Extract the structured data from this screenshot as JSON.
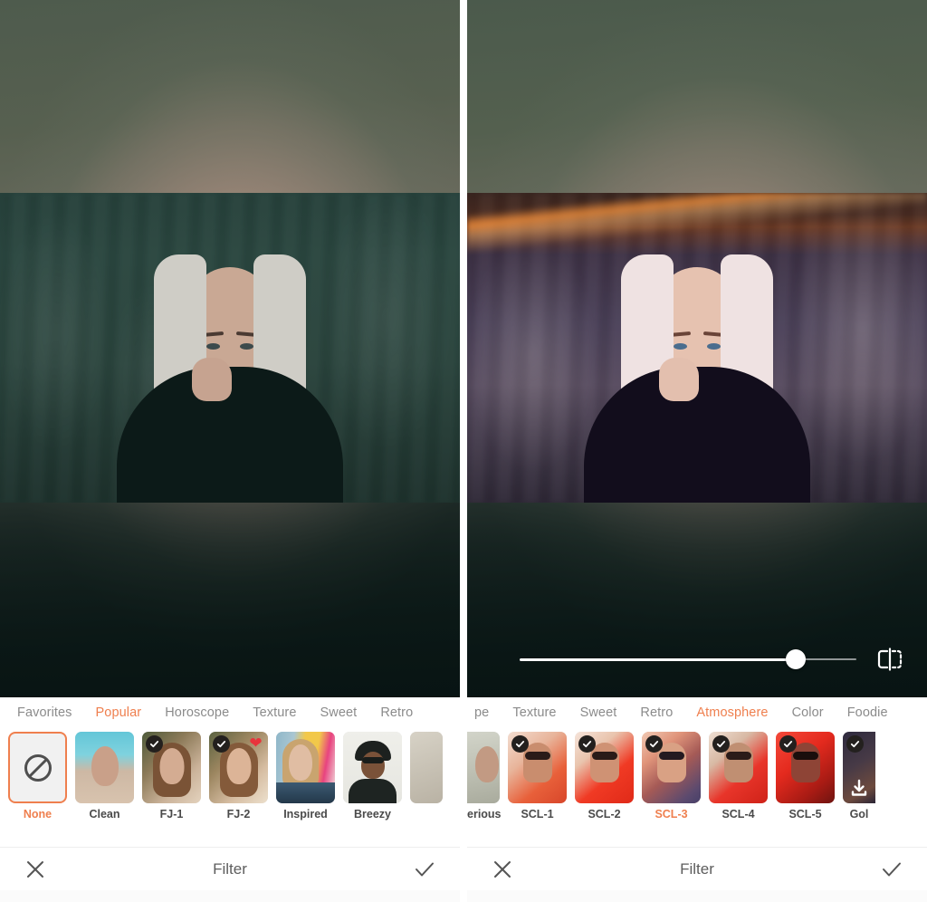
{
  "app": {
    "bottom_bar": {
      "title": "Filter",
      "cancel_icon": "close-x-icon",
      "confirm_icon": "check-icon"
    }
  },
  "left_panel": {
    "canvas": {
      "photo_description": "portrait of woman with platinum hair, original teal-green tone"
    },
    "tabs": [
      {
        "label": "Favorites",
        "active": false
      },
      {
        "label": "Popular",
        "active": true
      },
      {
        "label": "Horoscope",
        "active": false
      },
      {
        "label": "Texture",
        "active": false
      },
      {
        "label": "Sweet",
        "active": false
      },
      {
        "label": "Retro",
        "active": false
      }
    ],
    "filters": [
      {
        "label": "None",
        "selected": true,
        "checked": false,
        "favorited": false,
        "download": false,
        "kind": "none"
      },
      {
        "label": "Clean",
        "selected": false,
        "checked": false,
        "favorited": false,
        "download": false,
        "kind": "beach"
      },
      {
        "label": "FJ-1",
        "selected": false,
        "checked": true,
        "favorited": false,
        "download": false,
        "kind": "warm"
      },
      {
        "label": "FJ-2",
        "selected": false,
        "checked": true,
        "favorited": true,
        "download": false,
        "kind": "warm2"
      },
      {
        "label": "Inspired",
        "selected": false,
        "checked": false,
        "favorited": false,
        "download": false,
        "kind": "pop"
      },
      {
        "label": "Breezy",
        "selected": false,
        "checked": false,
        "favorited": false,
        "download": false,
        "kind": "bw"
      }
    ]
  },
  "right_panel": {
    "canvas": {
      "photo_description": "same portrait with warm SCL-3 atmosphere filter applied"
    },
    "slider": {
      "value": 82,
      "min": 0,
      "max": 100,
      "compare_icon": "compare-before-after-icon"
    },
    "tabs": [
      {
        "label": "pe",
        "active": false
      },
      {
        "label": "Texture",
        "active": false
      },
      {
        "label": "Sweet",
        "active": false
      },
      {
        "label": "Retro",
        "active": false
      },
      {
        "label": "Atmosphere",
        "active": true
      },
      {
        "label": "Color",
        "active": false
      },
      {
        "label": "Foodie",
        "active": false
      }
    ],
    "filters": [
      {
        "label": "erious",
        "selected": false,
        "checked": false,
        "favorited": false,
        "download": false,
        "kind": "pale",
        "partial": true
      },
      {
        "label": "SCL-1",
        "selected": false,
        "checked": true,
        "favorited": false,
        "download": false,
        "kind": "red1",
        "partial": false
      },
      {
        "label": "SCL-2",
        "selected": false,
        "checked": true,
        "favorited": false,
        "download": false,
        "kind": "red2",
        "partial": false
      },
      {
        "label": "SCL-3",
        "selected": true,
        "checked": true,
        "favorited": false,
        "download": false,
        "kind": "red3",
        "partial": false
      },
      {
        "label": "SCL-4",
        "selected": false,
        "checked": true,
        "favorited": false,
        "download": false,
        "kind": "red4",
        "partial": false
      },
      {
        "label": "SCL-5",
        "selected": false,
        "checked": true,
        "favorited": false,
        "download": false,
        "kind": "red5",
        "partial": false
      },
      {
        "label": "Gol",
        "selected": false,
        "checked": true,
        "favorited": false,
        "download": true,
        "kind": "dark",
        "partial": true
      }
    ]
  },
  "colors": {
    "accent": "#ef7f4e",
    "tab_inactive": "#8b8b8b",
    "label": "#4a4a4a",
    "heart": "#e8343c",
    "badge_bg": "#23201e",
    "panel_bg": "#ffffff"
  }
}
